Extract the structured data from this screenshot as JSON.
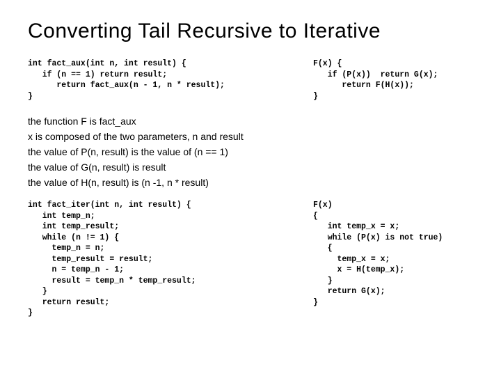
{
  "title": "Converting Tail Recursive  to Iterative",
  "code_top_left": "int fact_aux(int n, int result) {\n   if (n == 1) return result;\n      return fact_aux(n - 1, n * result);\n}",
  "code_top_right": "F(x) {\n   if (P(x))  return G(x);\n      return F(H(x));\n}",
  "explain": {
    "l1": "the function F is fact_aux",
    "l2": "x is composed of the two parameters, n and result",
    "l3": "the value of P(n, result) is the value of (n == 1)",
    "l4": "the value of G(n, result) is result",
    "l5": "the value of H(n, result) is (n -1, n * result)"
  },
  "code_bottom_left": "int fact_iter(int n, int result) {\n   int temp_n;\n   int temp_result;\n   while (n != 1) {\n     temp_n = n;\n     temp_result = result;\n     n = temp_n - 1;\n     result = temp_n * temp_result;\n   }\n   return result;\n}",
  "code_bottom_right": "F(x)\n{\n   int temp_x = x;\n   while (P(x) is not true)\n   {\n     temp_x = x;\n     x = H(temp_x);\n   }\n   return G(x);\n}"
}
